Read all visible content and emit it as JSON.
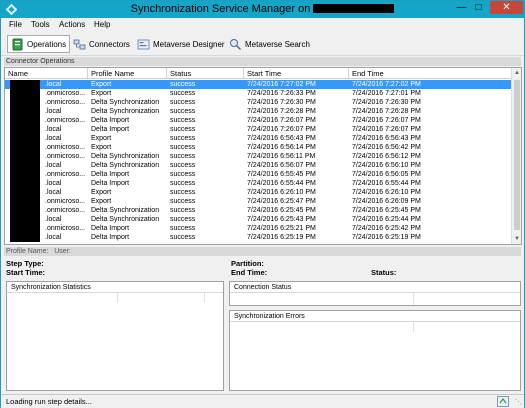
{
  "window": {
    "title": "Synchronization Service Manager on"
  },
  "menu": [
    "File",
    "Tools",
    "Actions",
    "Help"
  ],
  "toolbar": [
    {
      "label": "Operations",
      "icon": "operations-icon",
      "active": true
    },
    {
      "label": "Connectors",
      "icon": "connectors-icon"
    },
    {
      "label": "Metaverse Designer",
      "icon": "metaverse-designer-icon"
    },
    {
      "label": "Metaverse Search",
      "icon": "metaverse-search-icon"
    }
  ],
  "connector_operations": {
    "title": "Connector Operations",
    "columns": [
      "Name",
      "Profile Name",
      "Status",
      "Start Time",
      "End Time"
    ],
    "rows": [
      {
        "name": ".local",
        "profile": "Export",
        "status": "success",
        "start": "7/24/2016 7:27:02 PM",
        "end": "7/24/2016 7:27:02 PM",
        "selected": true
      },
      {
        "name": ".onmicroso...",
        "profile": "Export",
        "status": "success",
        "start": "7/24/2016 7:26:33 PM",
        "end": "7/24/2016 7:27:01 PM"
      },
      {
        "name": ".onmicroso...",
        "profile": "Delta Synchronization",
        "status": "success",
        "start": "7/24/2016 7:26:30 PM",
        "end": "7/24/2016 7:26:30 PM"
      },
      {
        "name": ".local",
        "profile": "Delta Synchronization",
        "status": "success",
        "start": "7/24/2016 7:26:28 PM",
        "end": "7/24/2016 7:26:28 PM"
      },
      {
        "name": ".onmicroso...",
        "profile": "Delta Import",
        "status": "success",
        "start": "7/24/2016 7:26:07 PM",
        "end": "7/24/2016 7:26:07 PM"
      },
      {
        "name": ".local",
        "profile": "Delta Import",
        "status": "success",
        "start": "7/24/2016 7:26:07 PM",
        "end": "7/24/2016 7:26:07 PM"
      },
      {
        "name": ".local",
        "profile": "Export",
        "status": "success",
        "start": "7/24/2016 6:56:43 PM",
        "end": "7/24/2016 6:56:43 PM"
      },
      {
        "name": ".onmicroso...",
        "profile": "Export",
        "status": "success",
        "start": "7/24/2016 6:56:14 PM",
        "end": "7/24/2016 6:56:42 PM"
      },
      {
        "name": ".onmicroso...",
        "profile": "Delta Synchronization",
        "status": "success",
        "start": "7/24/2016 6:56:11 PM",
        "end": "7/24/2016 6:56:12 PM"
      },
      {
        "name": ".local",
        "profile": "Delta Synchronization",
        "status": "success",
        "start": "7/24/2016 6:56:07 PM",
        "end": "7/24/2016 6:56:10 PM"
      },
      {
        "name": ".onmicroso...",
        "profile": "Delta Import",
        "status": "success",
        "start": "7/24/2016 6:55:45 PM",
        "end": "7/24/2016 6:56:05 PM"
      },
      {
        "name": ".local",
        "profile": "Delta Import",
        "status": "success",
        "start": "7/24/2016 6:55:44 PM",
        "end": "7/24/2016 6:55:44 PM"
      },
      {
        "name": ".local",
        "profile": "Export",
        "status": "success",
        "start": "7/24/2016 6:26:10 PM",
        "end": "7/24/2016 6:26:10 PM"
      },
      {
        "name": ".onmicroso...",
        "profile": "Export",
        "status": "success",
        "start": "7/24/2016 6:25:47 PM",
        "end": "7/24/2016 6:26:09 PM"
      },
      {
        "name": ".onmicroso...",
        "profile": "Delta Synchronization",
        "status": "success",
        "start": "7/24/2016 6:25:45 PM",
        "end": "7/24/2016 6:25:45 PM"
      },
      {
        "name": ".local",
        "profile": "Delta Synchronization",
        "status": "success",
        "start": "7/24/2016 6:25:43 PM",
        "end": "7/24/2016 6:25:44 PM"
      },
      {
        "name": ".onmicroso...",
        "profile": "Delta Import",
        "status": "success",
        "start": "7/24/2016 6:25:21 PM",
        "end": "7/24/2016 6:25:42 PM"
      },
      {
        "name": ".local",
        "profile": "Delta Import",
        "status": "success",
        "start": "7/24/2016 6:25:19 PM",
        "end": "7/24/2016 6:25:19 PM"
      }
    ]
  },
  "details": {
    "profile_name_label": "Profile Name:",
    "user_label": "User:",
    "step_type_label": "Step Type:",
    "start_time_label": "Start Time:",
    "partition_label": "Partition:",
    "end_time_label": "End Time:",
    "status_label": "Status:"
  },
  "panels": {
    "sync_stats": "Synchronization Statistics",
    "connection_status": "Connection Status",
    "sync_errors": "Synchronization Errors"
  },
  "statusbar": {
    "text": "Loading run step details..."
  },
  "colors": {
    "titlebar": "#14a5c8",
    "selection": "#3399ff",
    "close": "#c7463c"
  }
}
